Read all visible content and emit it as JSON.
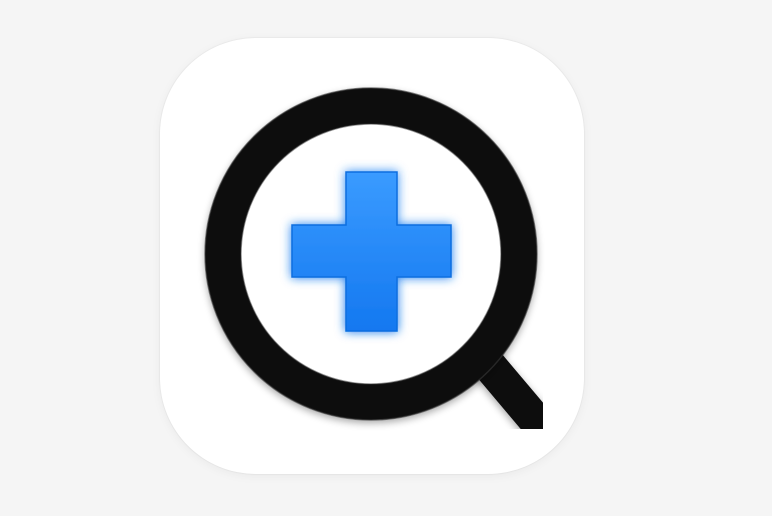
{
  "icon": {
    "name": "medical-search-app-icon",
    "symbol": "magnifier-with-plus",
    "colors": {
      "page_background": "#f5f5f5",
      "tile": "#ffffff",
      "magnifier": "#0a0a0a",
      "cross": "#1e88f5"
    }
  }
}
